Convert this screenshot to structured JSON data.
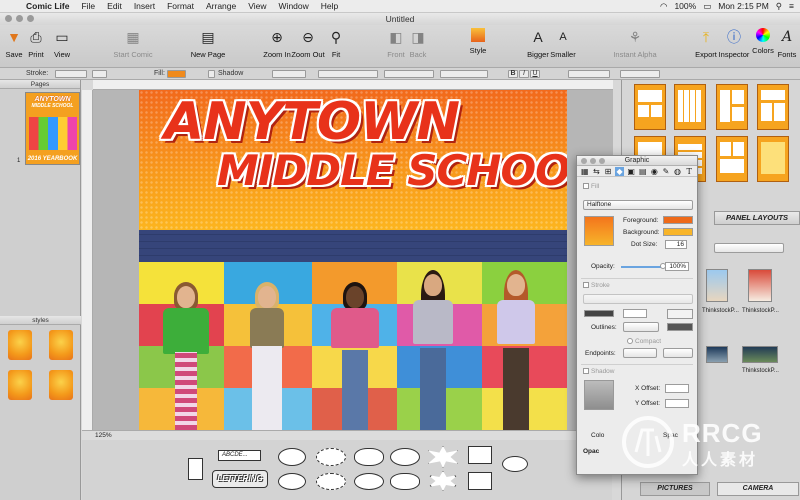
{
  "menubar": {
    "app_name": "Comic Life",
    "items": [
      "File",
      "Edit",
      "Insert",
      "Format",
      "Arrange",
      "View",
      "Window",
      "Help"
    ],
    "battery": "100%",
    "clock": "Mon 2:15 PM"
  },
  "window": {
    "title": "Untitled"
  },
  "toolbar": {
    "save": "Save",
    "print": "Print",
    "view": "View",
    "start_comic": "Start Comic",
    "new_page": "New Page",
    "zoom_in": "Zoom In",
    "zoom_out": "Zoom Out",
    "fit": "Fit",
    "front": "Front",
    "back": "Back",
    "style": "Style",
    "bigger": "Bigger",
    "smaller": "Smaller",
    "instant_alpha": "Instant Alpha",
    "export": "Export",
    "inspector": "Inspector",
    "colors": "Colors",
    "fonts": "Fonts"
  },
  "format_bar": {
    "stroke_label": "Stroke:",
    "fill_label": "Fill:",
    "shadow_label": "Shadow",
    "style_buttons": [
      "B",
      "I",
      "U"
    ]
  },
  "left_pane": {
    "pages_header": "Pages",
    "page_number": "1",
    "thumbnail_lines": [
      "ANYTOWN",
      "MIDDLE SCHOOL",
      "2016 YEARBOOK"
    ],
    "styles_header": "styles"
  },
  "page": {
    "headline_line1": "ANYTOWN",
    "headline_line2": "MIDDLE SCHOOL"
  },
  "zoom": {
    "value": "125%"
  },
  "lettering": {
    "sample_text": "ABCDE...",
    "lettering_art": "LETTERING"
  },
  "right_pane": {
    "panel_layouts_button": "PANEL LAYOUTS",
    "photo_labels": [
      "ThinkstockP...",
      "ThinkstockP...",
      "ThinkstockP..."
    ],
    "pictures_button": "PICTURES",
    "camera_button": "CAMERA"
  },
  "inspector": {
    "title": "Graphic",
    "fill_label": "Fill",
    "fill_type": "Halftone",
    "foreground_label": "Foreground:",
    "background_label": "Background:",
    "dot_size_label": "Dot Size:",
    "dot_size_value": "16",
    "opacity_label": "Opacity:",
    "opacity_value": "100%",
    "opacity_level": 1.0,
    "stroke_label": "Stroke",
    "outlines_label": "Outlines:",
    "compact_label": "Compact",
    "endpoints_label": "Endpoints:",
    "shadow_label": "Shadow",
    "x_offset_label": "X Offset:",
    "y_offset_label": "Y Offset:",
    "color_label": "Colo",
    "opacity_short": "Opac",
    "spacing_short": "Spac"
  },
  "watermark": {
    "logo_text": "RRCG",
    "cjk_text": "人人素材"
  },
  "colors": {
    "accent_orange": "#f4991a",
    "headline_red": "#e8321a",
    "brick_blue": "#36457a"
  }
}
